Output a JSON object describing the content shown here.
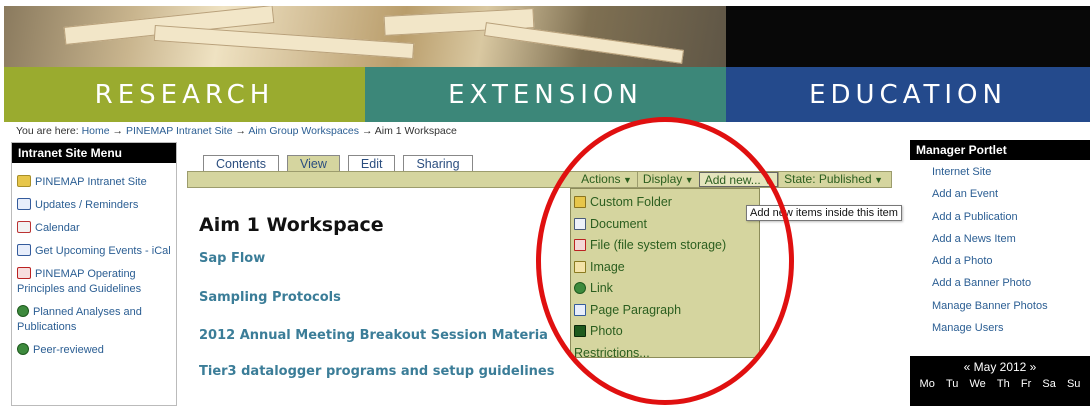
{
  "banner": {
    "research": "RESEARCH",
    "extension": "EXTENSION",
    "education": "EDUCATION"
  },
  "breadcrumb": {
    "prefix": "You are here:",
    "items": [
      "Home",
      "PINEMAP Intranet Site",
      "Aim Group Workspaces",
      "Aim 1 Workspace"
    ],
    "separator": "→"
  },
  "left_menu": {
    "title": "Intranet Site Menu",
    "items": [
      {
        "label": "PINEMAP Intranet Site",
        "icon": "folder-icon"
      },
      {
        "label": "Updates / Reminders",
        "icon": "document-icon"
      },
      {
        "label": "Calendar",
        "icon": "calendar-icon"
      },
      {
        "label": "Get Upcoming Events - iCal",
        "icon": "document-icon"
      },
      {
        "label": "PINEMAP Operating Principles and Guidelines",
        "icon": "pdf-icon"
      },
      {
        "label": "Planned Analyses and Publications",
        "icon": "globe-icon"
      },
      {
        "label": "Peer-reviewed",
        "icon": "globe-icon"
      }
    ]
  },
  "content_tabs": [
    "Contents",
    "View",
    "Edit",
    "Sharing"
  ],
  "active_tab": "View",
  "action_menu": {
    "actions": "Actions",
    "display": "Display",
    "add_new": "Add new...",
    "state": "State: Published"
  },
  "page": {
    "title": "Aim 1 Workspace",
    "links": [
      "Sap Flow",
      "Sampling Protocols",
      "2012 Annual Meeting Breakout Session Materia",
      "Tier3 datalogger programs and setup guidelines"
    ]
  },
  "add_new_dropdown": {
    "items": [
      {
        "label": "Custom Folder",
        "icon": "folder-icon"
      },
      {
        "label": "Document",
        "icon": "document-icon"
      },
      {
        "label": "File (file system storage)",
        "icon": "file-icon"
      },
      {
        "label": "Image",
        "icon": "image-icon"
      },
      {
        "label": "Link",
        "icon": "link-icon"
      },
      {
        "label": "Page Paragraph",
        "icon": "page-paragraph-icon"
      },
      {
        "label": "Photo",
        "icon": "photo-icon"
      }
    ],
    "restrictions": "Restrictions..."
  },
  "tooltip": "Add new items inside this item",
  "manager_portlet": {
    "title": "Manager Portlet",
    "items": [
      "Internet Site",
      "Add an Event",
      "Add a Publication",
      "Add a News Item",
      "Add a Photo",
      "Add a Banner Photo",
      "Manage Banner Photos",
      "Manage Users"
    ]
  },
  "calendar": {
    "title": "« May 2012 »",
    "days": [
      "Mo",
      "Tu",
      "We",
      "Th",
      "Fr",
      "Sa",
      "Su"
    ]
  },
  "colors": {
    "research": "#9aab2f",
    "extension": "#3c8779",
    "education": "#244a8c",
    "annotation": "#e01010",
    "menu_bg": "#d5d59f"
  }
}
